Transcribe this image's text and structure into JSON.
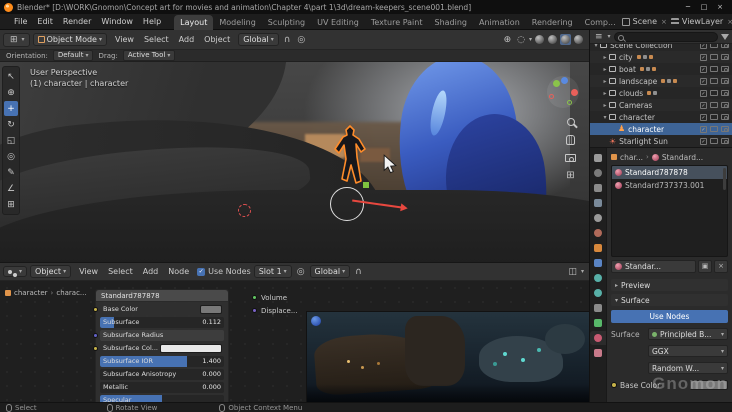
{
  "accent": {
    "blue": "#4772b3",
    "orange": "#ff8c2a"
  },
  "titlebar": {
    "title": "Blender* [D:\\WORK\\Gnomon\\Concept art for movies and animation\\Chapter 4\\part 1\\3d\\dream-keepers_scene001.blend]",
    "minimize": "─",
    "maximize": "□",
    "close": "×"
  },
  "topbar": {
    "menus": [
      "File",
      "Edit",
      "Render",
      "Window",
      "Help"
    ],
    "workspaces": [
      {
        "label": "Layout",
        "active": true
      },
      {
        "label": "Modeling"
      },
      {
        "label": "Sculpting"
      },
      {
        "label": "UV Editing"
      },
      {
        "label": "Texture Paint"
      },
      {
        "label": "Shading"
      },
      {
        "label": "Animation"
      },
      {
        "label": "Rendering"
      },
      {
        "label": "Comp..."
      }
    ],
    "scene": {
      "label": "Scene",
      "unlink": "×"
    },
    "viewlayer": {
      "label": "ViewLayer",
      "unlink": "×"
    }
  },
  "viewport": {
    "header": {
      "mode": "Object Mode",
      "menus": [
        "View",
        "Select",
        "Add",
        "Object"
      ],
      "orientation": "Global"
    },
    "tool_settings": {
      "orientation_label": "Orientation:",
      "orientation_value": "Default",
      "drag_label": "Drag:",
      "drag_value": "Active Tool"
    },
    "overlay": {
      "perspective": "User Perspective",
      "selection": "(1) character | character"
    },
    "tools": [
      "select",
      "cursor",
      "move",
      "rotate",
      "scale",
      "transform",
      "annotate",
      "measure",
      "add-cube"
    ],
    "active_tool_index": 2
  },
  "icons": {
    "select": "↖",
    "cursor": "⊕",
    "move": "+",
    "rotate": "↻",
    "scale": "◱",
    "transform": "◎",
    "annotate": "✎",
    "measure": "∠",
    "add-cube": "⊞",
    "grid": "⊞",
    "check": "✓"
  },
  "outliner": {
    "rows": [
      {
        "label": "Scene Collection",
        "icon": "collection",
        "depth": 0,
        "caret": "▾"
      },
      {
        "label": "city",
        "icon": "collection",
        "depth": 1,
        "caret": "▸",
        "dots": 3
      },
      {
        "label": "boat",
        "icon": "collection",
        "depth": 1,
        "caret": "▸",
        "dots": 3
      },
      {
        "label": "landscape",
        "icon": "collection",
        "depth": 1,
        "caret": "▸",
        "dots": 3
      },
      {
        "label": "clouds",
        "icon": "collection",
        "depth": 1,
        "caret": "▸",
        "dots": 2
      },
      {
        "label": "Cameras",
        "icon": "collection",
        "depth": 1,
        "caret": "▸"
      },
      {
        "label": "character",
        "icon": "collection",
        "depth": 1,
        "caret": "▾"
      },
      {
        "label": "character",
        "icon": "object-person",
        "depth": 2,
        "selected": true
      },
      {
        "label": "Starlight Sun",
        "icon": "light-sun",
        "depth": 1
      }
    ]
  },
  "properties": {
    "tabs": [
      {
        "name": "tool",
        "color": "#9a9a9a"
      },
      {
        "name": "render",
        "color": "#7a7a7a",
        "round": true
      },
      {
        "name": "output",
        "color": "#8a8a8a"
      },
      {
        "name": "view-layer",
        "color": "#7a8a9a"
      },
      {
        "name": "scene",
        "color": "#9a9a9a",
        "round": true
      },
      {
        "name": "world",
        "color": "#b06a5a",
        "round": true
      },
      {
        "name": "object",
        "color": "#d8883c"
      },
      {
        "name": "modifiers",
        "color": "#5a84c4"
      },
      {
        "name": "particles",
        "color": "#58b0a8",
        "round": true
      },
      {
        "name": "physics",
        "color": "#58b0a8",
        "round": true
      },
      {
        "name": "constraints",
        "color": "#8a8a8a"
      },
      {
        "name": "object-data",
        "color": "#58b86a"
      },
      {
        "name": "material",
        "color": "#c85a72",
        "round": true,
        "active": true
      },
      {
        "name": "texture",
        "color": "#c87a8a"
      }
    ],
    "breadcrumb_object": "char...",
    "breadcrumb_material": "Standard...",
    "slots": [
      {
        "name": "Standard787878",
        "selected": true
      },
      {
        "name": "Standard737373.001"
      }
    ],
    "datablock": {
      "name": "Standar...",
      "shield": "▣",
      "unlink": "×"
    },
    "preview_section": "Preview",
    "surface_section": "Surface",
    "use_nodes": "Use Nodes",
    "surface_label": "Surface",
    "surface_shader": "Principled B...",
    "distribution": "GGX",
    "subsurface_method": "Random W...",
    "base_color_label": "Base Color"
  },
  "shader": {
    "header": {
      "type": "Object",
      "menus": [
        "View",
        "Select",
        "Add",
        "Node"
      ],
      "use_nodes": "Use Nodes",
      "slot": "Slot 1",
      "orientation": "Global"
    },
    "path": {
      "object": "character",
      "material": "charac..."
    },
    "node": {
      "title": "Standard787878",
      "rows": [
        {
          "label": "Base Color",
          "widget": "color-gray",
          "socket": "#c7b34a"
        },
        {
          "label": "Subsurface",
          "value": "0.112",
          "widget": "slider",
          "fill": 0.11,
          "socket": "#a1a1a1"
        },
        {
          "label": "Subsurface Radius",
          "widget": "button",
          "socket": "#6363c7"
        },
        {
          "label": "Subsurface Col...",
          "widget": "color-white",
          "socket": "#c7b34a"
        },
        {
          "label": "Subsurface IOR",
          "value": "1.400",
          "widget": "slider",
          "fill": 0.7,
          "socket": "#a1a1a1"
        },
        {
          "label": "Subsurface Anisotropy",
          "value": "0.000",
          "widget": "slider",
          "fill": 0.0,
          "socket": "#a1a1a1"
        },
        {
          "label": "Metallic",
          "value": "0.000",
          "widget": "slider",
          "fill": 0.0,
          "socket": "#a1a1a1"
        },
        {
          "label": "Specular",
          "widget": "slider",
          "fill": 0.5,
          "socket": "#a1a1a1"
        }
      ],
      "outputs": [
        {
          "label": "Volume",
          "color": "#63c763"
        },
        {
          "label": "Displace...",
          "color": "#7a63c7"
        }
      ]
    }
  },
  "statusbar": {
    "items": [
      {
        "label": "Select",
        "icon": "mouse-left"
      },
      {
        "label": "Rotate View",
        "icon": "mouse-middle"
      },
      {
        "label": "Object Context Menu",
        "icon": "mouse-right"
      }
    ]
  },
  "watermark": {
    "text": "Gnomon"
  }
}
